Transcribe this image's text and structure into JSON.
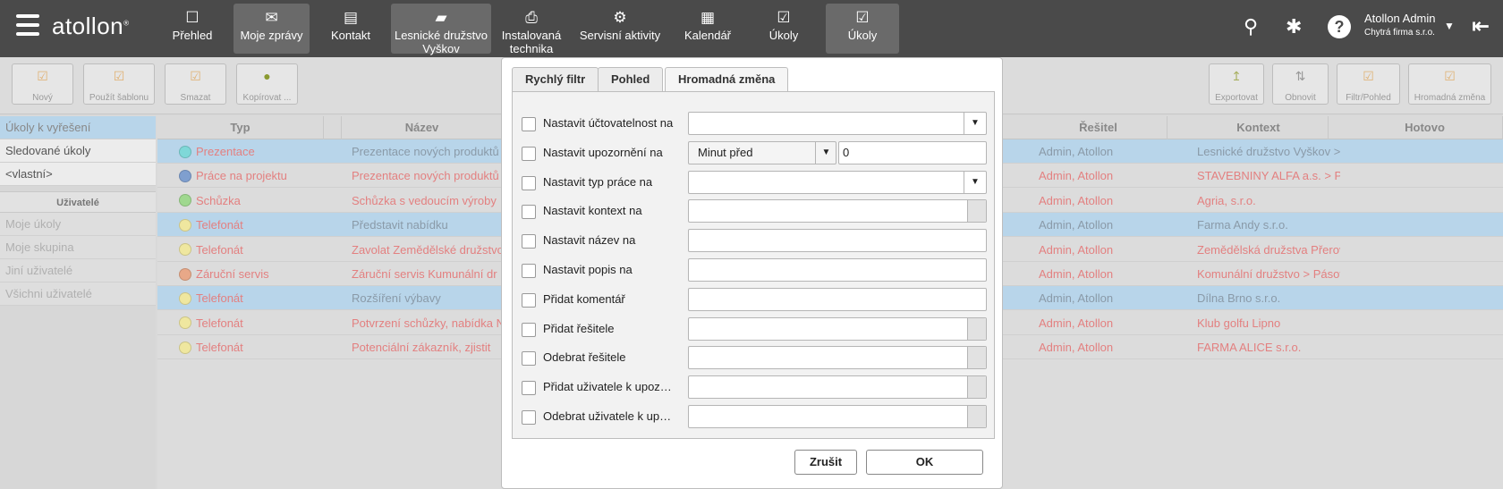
{
  "app": {
    "logo": "atollon",
    "logo_mark": "®"
  },
  "nav": [
    {
      "label": "Přehled",
      "icon": "☐"
    },
    {
      "label": "Moje zprávy",
      "icon": "✉"
    },
    {
      "label": "Kontakt",
      "icon": "▤"
    },
    {
      "label": "Lesnické družstvo Vyškov",
      "icon": "▰"
    },
    {
      "label": "Instalovaná technika",
      "icon": "⎙"
    },
    {
      "label": "Servisní aktivity",
      "icon": "⚙"
    },
    {
      "label": "Kalendář",
      "icon": "▦"
    },
    {
      "label": "Úkoly",
      "icon": "☑"
    },
    {
      "label": "Úkoly",
      "icon": "☑"
    }
  ],
  "user": {
    "name": "Atollon Admin",
    "company": "Chytrá firma s.r.o."
  },
  "toolbar_left": [
    "Nový",
    "Použít šablonu",
    "Smazat",
    "Kopírovat ..."
  ],
  "toolbar_right": [
    "Exportovat",
    "Obnovit",
    "Filtr/Pohled",
    "Hromadná změna"
  ],
  "left_panel": {
    "items": [
      "Úkoly k vyřešení",
      "Sledované úkoly",
      "<vlastní>"
    ],
    "section": "Uživatelé",
    "user_items": [
      "Moje úkoly",
      "Moje skupina",
      "Jiní uživatelé",
      "Všichni uživatelé"
    ]
  },
  "grid": {
    "columns": [
      "Typ",
      "Název",
      "Řešitel",
      "Kontext",
      "Hotovo"
    ],
    "rows": [
      {
        "type": "Prezentace",
        "color": "#7fd8d8",
        "name": "Prezentace nových produktů",
        "solver": "Admin, Atollon",
        "context": "Lesnické družstvo Vyškov > P",
        "selected": true
      },
      {
        "type": "Práce na projektu",
        "color": "#7f9fcf",
        "name": "Prezentace nových produktů",
        "solver": "Admin, Atollon",
        "context": "STAVEBNINY ALFA a.s. > Proc",
        "selected": false
      },
      {
        "type": "Schůzka",
        "color": "#9fd88f",
        "name": "Schůzka s vedoucím výroby",
        "solver": "Admin, Atollon",
        "context": "Agria, s.r.o.",
        "selected": false
      },
      {
        "type": "Telefonát",
        "color": "#efe79f",
        "name": "Představit nabídku",
        "solver": "Admin, Atollon",
        "context": "Farma Andy s.r.o.",
        "selected": true
      },
      {
        "type": "Telefonát",
        "color": "#efe79f",
        "name": "Zavolat Zemědělské družstvo",
        "solver": "Admin, Atollon",
        "context": "Zemědělská družstva Přerov",
        "selected": false
      },
      {
        "type": "Záruční servis",
        "color": "#e8a888",
        "name": "Záruční servis Kumunální dr",
        "solver": "Admin, Atollon",
        "context": "Komunální družstvo > Pásový",
        "selected": false
      },
      {
        "type": "Telefonát",
        "color": "#efe79f",
        "name": "Rozšíření výbavy",
        "solver": "Admin, Atollon",
        "context": "Dílna Brno s.r.o.",
        "selected": true
      },
      {
        "type": "Telefonát",
        "color": "#efe79f",
        "name": "Potvrzení schůzky, nabídka N",
        "solver": "Admin, Atollon",
        "context": "Klub golfu Lipno",
        "selected": false
      },
      {
        "type": "Telefonát",
        "color": "#efe79f",
        "name": "Potenciální zákazník, zjistit",
        "solver": "Admin, Atollon",
        "context": "FARMA ALICE s.r.o.",
        "selected": false
      }
    ]
  },
  "modal": {
    "tabs": [
      "Rychlý filtr",
      "Pohled",
      "Hromadná změna"
    ],
    "fields": [
      {
        "label": "Nastavit účtovatelnost na",
        "kind": "select",
        "value": ""
      },
      {
        "label": "Nastavit upozornění na",
        "kind": "select+input",
        "value": "Minut před",
        "value2": "0"
      },
      {
        "label": "Nastavit typ práce na",
        "kind": "select",
        "value": ""
      },
      {
        "label": "Nastavit kontext na",
        "kind": "picker",
        "value": ""
      },
      {
        "label": "Nastavit název na",
        "kind": "text",
        "value": ""
      },
      {
        "label": "Nastavit popis na",
        "kind": "text",
        "value": ""
      },
      {
        "label": "Přidat komentář",
        "kind": "text",
        "value": ""
      },
      {
        "label": "Přidat řešitele",
        "kind": "picker",
        "value": ""
      },
      {
        "label": "Odebrat řešitele",
        "kind": "picker",
        "value": ""
      },
      {
        "label": "Přidat uživatele k upozorn...",
        "kind": "picker",
        "value": ""
      },
      {
        "label": "Odebrat uživatele k upoz...",
        "kind": "picker",
        "value": ""
      }
    ],
    "cancel": "Zrušit",
    "ok": "OK"
  }
}
